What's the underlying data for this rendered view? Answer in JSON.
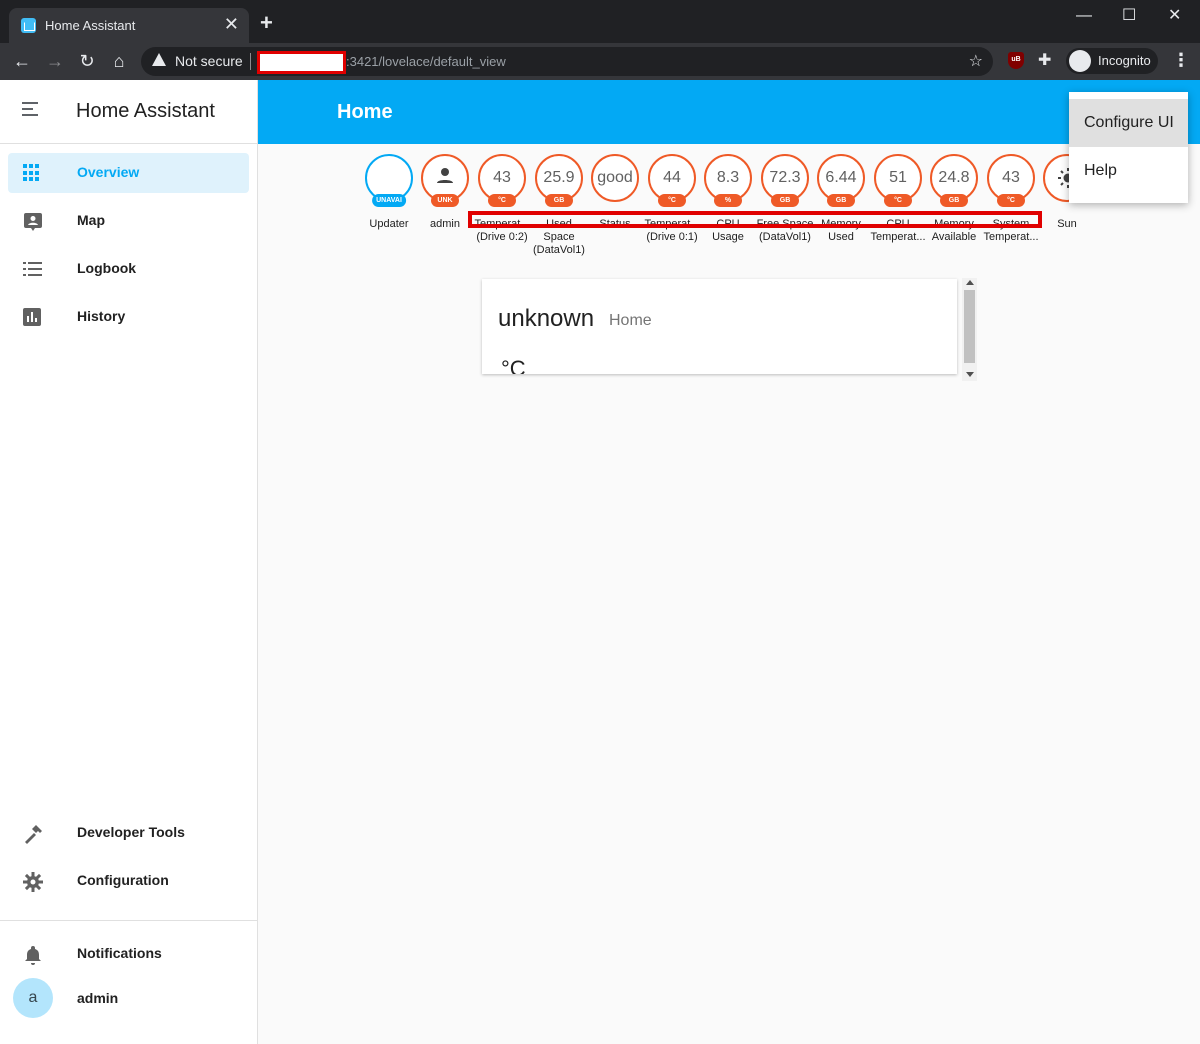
{
  "browser": {
    "tab_title": "Home Assistant",
    "tab_close": "✕",
    "new_tab": "+",
    "security_label": "Not secure",
    "url_visible": ":3421/lovelace/default_view",
    "profile_label": "Incognito",
    "extension_label": "uB",
    "window_controls": {
      "minimize": "—",
      "maximize": "☐",
      "close": "✕"
    },
    "nav": {
      "back": "←",
      "forward": "→",
      "reload": "↻",
      "home": "⌂",
      "bookmark": "☆",
      "menu": "⋮",
      "extensions": "✚"
    }
  },
  "sidebar": {
    "title": "Home Assistant",
    "items": [
      {
        "label": "Overview",
        "icon": "grid-icon",
        "active": true
      },
      {
        "label": "Map",
        "icon": "map-account-icon"
      },
      {
        "label": "Logbook",
        "icon": "list-icon"
      },
      {
        "label": "History",
        "icon": "chart-box-icon"
      }
    ],
    "bottom_items": [
      {
        "label": "Developer Tools",
        "icon": "hammer-icon"
      },
      {
        "label": "Configuration",
        "icon": "gear-icon"
      }
    ],
    "notifications_label": "Notifications",
    "user": {
      "avatar_letter": "a",
      "name": "admin"
    }
  },
  "header": {
    "title": "Home"
  },
  "menu": {
    "items": [
      "Configure UI",
      "Help"
    ]
  },
  "badges": [
    {
      "value": "",
      "unit": "UNAVAI",
      "label": "Updater",
      "color": "#03a9f4"
    },
    {
      "value": "",
      "unit": "UNK",
      "label": "admin",
      "icon": "person-icon",
      "color": "#ef5a27"
    },
    {
      "value": "43",
      "unit": "°C",
      "label": "Temperat... (Drive 0:2)",
      "color": "#ef5a27"
    },
    {
      "value": "25.9",
      "unit": "GB",
      "label": "Used Space (DataVol1)",
      "color": "#ef5a27"
    },
    {
      "value": "good",
      "unit": "",
      "label": "Status",
      "color": "#ef5a27"
    },
    {
      "value": "44",
      "unit": "°C",
      "label": "Temperat... (Drive 0:1)",
      "color": "#ef5a27"
    },
    {
      "value": "8.3",
      "unit": "%",
      "label": "CPU Usage",
      "color": "#ef5a27"
    },
    {
      "value": "72.3",
      "unit": "GB",
      "label": "Free Space (DataVol1)",
      "color": "#ef5a27"
    },
    {
      "value": "6.44",
      "unit": "GB",
      "label": "Memory Used",
      "color": "#ef5a27"
    },
    {
      "value": "51",
      "unit": "°C",
      "label": "CPU Temperat...",
      "color": "#ef5a27"
    },
    {
      "value": "24.8",
      "unit": "GB",
      "label": "Memory Available",
      "color": "#ef5a27"
    },
    {
      "value": "43",
      "unit": "°C",
      "label": "System Temperat...",
      "color": "#ef5a27"
    },
    {
      "value": "",
      "unit": "",
      "label": "Sun",
      "icon": "sun-icon",
      "color": "#ef5a27"
    }
  ],
  "card": {
    "state": "unknown",
    "name": "Home",
    "unit": "°C"
  },
  "colors": {
    "accent": "#03a9f4",
    "badge_border": "#ef5a27",
    "annotation_red": "#e00000"
  }
}
